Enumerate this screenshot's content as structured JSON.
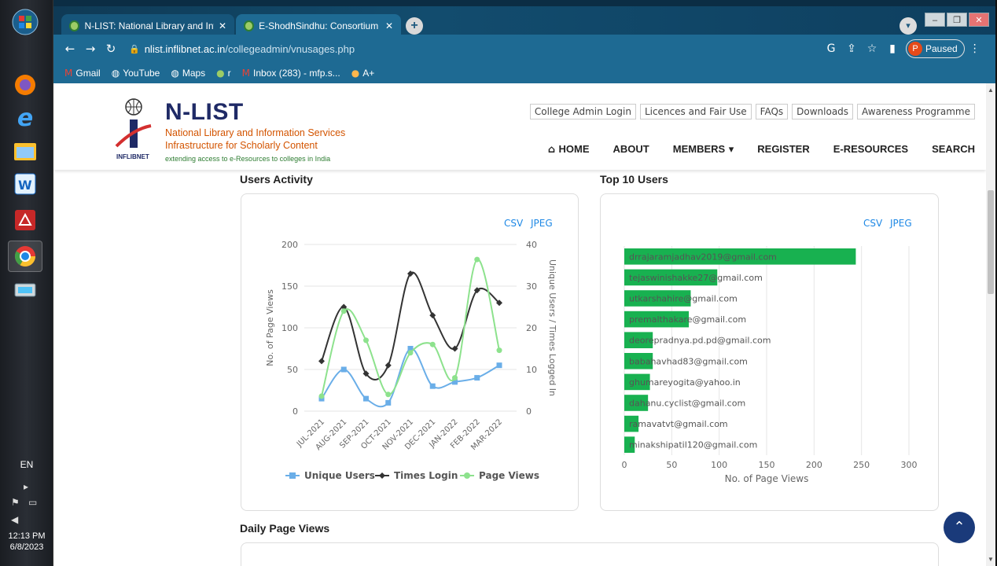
{
  "taskbar": {
    "language": "EN",
    "time": "12:13 PM",
    "date": "6/8/2023"
  },
  "browser": {
    "tabs": [
      {
        "title": "N-LIST: National Library and Info",
        "active": true
      },
      {
        "title": "E-ShodhSindhu: Consortium for",
        "active": false
      }
    ],
    "url_host": "nlist.inflibnet.ac.in",
    "url_path": "/collegeadmin/vnusages.php",
    "profile_initial": "P",
    "profile_status": "Paused",
    "bookmarks": [
      {
        "label": "Gmail",
        "icon": "gmail-icon"
      },
      {
        "label": "YouTube",
        "icon": "globe-icon"
      },
      {
        "label": "Maps",
        "icon": "globe-icon"
      },
      {
        "label": "r",
        "icon": "site-icon"
      },
      {
        "label": "Inbox (283) - mfp.s...",
        "icon": "gmail-icon"
      },
      {
        "label": "A+",
        "icon": "site-icon"
      }
    ]
  },
  "site": {
    "name": "N-LIST",
    "line1": "National Library and Information Services",
    "line2": "Infrastructure for Scholarly Content",
    "tagline": "extending access to e-Resources to colleges in India",
    "logo_text": "INFLIBNET",
    "top_links": [
      "College Admin Login",
      "Licences and Fair Use",
      "FAQs",
      "Downloads",
      "Awareness Programme"
    ],
    "nav": [
      "HOME",
      "ABOUT",
      "MEMBERS",
      "REGISTER",
      "E-RESOURCES",
      "SEARCH"
    ]
  },
  "sections": {
    "users_activity": "Users Activity",
    "top10": "Top 10 Users",
    "daily": "Daily Page Views",
    "export_csv": "CSV",
    "export_jpeg": "JPEG"
  },
  "chart_data": [
    {
      "type": "line",
      "categories": [
        "JUL-2021",
        "AUG-2021",
        "SEP-2021",
        "OCT-2021",
        "NOV-2021",
        "DEC-2021",
        "JAN-2022",
        "FEB-2022",
        "MAR-2022"
      ],
      "ylabel": "No. of Page Views",
      "y2label": "Unique Users / Times Logged In",
      "ylim": [
        0,
        200
      ],
      "y2lim": [
        0,
        40
      ],
      "yticks": [
        0,
        50,
        100,
        150,
        200
      ],
      "y2ticks": [
        0,
        10,
        20,
        30,
        40
      ],
      "legend_position": "bottom",
      "series": [
        {
          "name": "Unique Users",
          "axis": "right",
          "color": "#6aaee8",
          "marker": "square",
          "values": [
            3,
            10,
            3,
            2,
            15,
            6,
            7,
            8,
            11
          ]
        },
        {
          "name": "Times Login",
          "axis": "right",
          "color": "#333333",
          "marker": "diamond",
          "values": [
            12,
            25,
            9,
            11,
            33,
            23,
            15,
            29,
            26
          ]
        },
        {
          "name": "Page Views",
          "axis": "left",
          "color": "#8de28d",
          "marker": "circle",
          "values": [
            18,
            120,
            85,
            20,
            70,
            80,
            40,
            182,
            73
          ]
        }
      ]
    },
    {
      "type": "bar",
      "orientation": "horizontal",
      "categories": [
        "drrajaramjadhav2019@gmail.com",
        "tejaswinishakke27@gmail.com",
        "utkarshahire@gmail.com",
        "premalthakare@gmail.com",
        "deorepradnya.pd.pd@gmail.com",
        "babahavhad83@gmail.com",
        "ghumareyogita@yahoo.in",
        "dahanu.cyclist@gmail.com",
        "ramavatvt@gmail.com",
        "minakshipatil120@gmail.com"
      ],
      "values": [
        244,
        98,
        70,
        68,
        30,
        30,
        27,
        25,
        15,
        11
      ],
      "xlabel": "No. of Page Views",
      "xlim": [
        0,
        300
      ],
      "xticks": [
        0,
        50,
        100,
        150,
        200,
        250,
        300
      ],
      "color": "#18b150"
    }
  ]
}
